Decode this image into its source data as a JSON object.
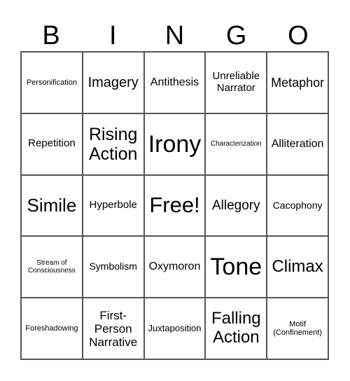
{
  "header": [
    "B",
    "I",
    "N",
    "G",
    "O"
  ],
  "cells": [
    {
      "text": "Personification",
      "size": 11
    },
    {
      "text": "Imagery",
      "size": 20
    },
    {
      "text": "Antithesis",
      "size": 16
    },
    {
      "text": "Unreliable Narrator",
      "size": 15
    },
    {
      "text": "Metaphor",
      "size": 18
    },
    {
      "text": "Repetition",
      "size": 15
    },
    {
      "text": "Rising Action",
      "size": 25
    },
    {
      "text": "Irony",
      "size": 34
    },
    {
      "text": "Characterization",
      "size": 10
    },
    {
      "text": "Alliteration",
      "size": 16
    },
    {
      "text": "Simile",
      "size": 26
    },
    {
      "text": "Hyperbole",
      "size": 15
    },
    {
      "text": "Free!",
      "size": 31
    },
    {
      "text": "Allegory",
      "size": 19
    },
    {
      "text": "Cacophony",
      "size": 14
    },
    {
      "text": "Stream of Consciousness",
      "size": 10
    },
    {
      "text": "Symbolism",
      "size": 14
    },
    {
      "text": "Oxymoron",
      "size": 16
    },
    {
      "text": "Tone",
      "size": 34
    },
    {
      "text": "Climax",
      "size": 24
    },
    {
      "text": "Foreshadowing",
      "size": 11
    },
    {
      "text": "First-Person Narrative",
      "size": 17
    },
    {
      "text": "Juxtaposition",
      "size": 13
    },
    {
      "text": "Falling Action",
      "size": 24
    },
    {
      "text": "Motif (Confinement)",
      "size": 11
    }
  ]
}
